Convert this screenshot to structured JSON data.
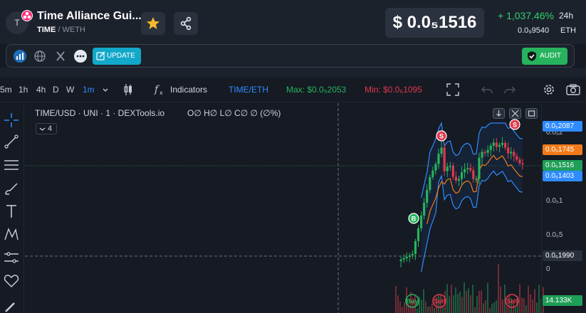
{
  "header": {
    "avatar_letter": "T",
    "token_name": "Time Alliance Gui...",
    "base": "TIME",
    "separator": "/",
    "quote": "WETH",
    "price": "$ 0.0₅1516",
    "change": "+ 1,037.46%",
    "period": "24h",
    "eth_price": "0.0₉9540",
    "eth_unit": "ETH"
  },
  "linkbar": {
    "update_label": "UPDATE",
    "audit_label": "AUDIT"
  },
  "toolbar": {
    "timeframes": [
      "5m",
      "1h",
      "4h",
      "D",
      "W",
      "1m"
    ],
    "active_timeframe": "1m",
    "indicators_label": "Indicators",
    "pair_label": "TIME/ETH",
    "max_label": "Max: $0.0₅2053",
    "min_label": "Min: $0.0₆1095"
  },
  "chart": {
    "title": "TIME/USD · UNI · 1 · DEXTools.io",
    "ohlc": "O∅ H∅ L∅ C∅ ∅ (∅%)",
    "indicator_count": "4",
    "axis_ticks": [
      "0.0₅2",
      "0.0₅1",
      "0.0₆5",
      "0"
    ],
    "tags": {
      "top_band": "0.0₅2087",
      "mid_band": "0.0₅1745",
      "last_price": "0.0₅1516",
      "low_band": "0.0₅1403",
      "crosshair": "0.0₆1990",
      "volume": "14.133K"
    },
    "markers": [
      {
        "label": "S",
        "kind": "sell"
      },
      {
        "label": "S",
        "kind": "sell"
      },
      {
        "label": "B",
        "kind": "buy"
      },
      {
        "label": "Buy",
        "kind": "buy"
      },
      {
        "label": "Sell",
        "kind": "sell"
      },
      {
        "label": "Sell",
        "kind": "sell"
      }
    ],
    "colors": {
      "up": "#27b35d",
      "down": "#e0394c",
      "band": "#2f8bff",
      "ma": "#f27a1a",
      "background": "#151a23"
    }
  }
}
